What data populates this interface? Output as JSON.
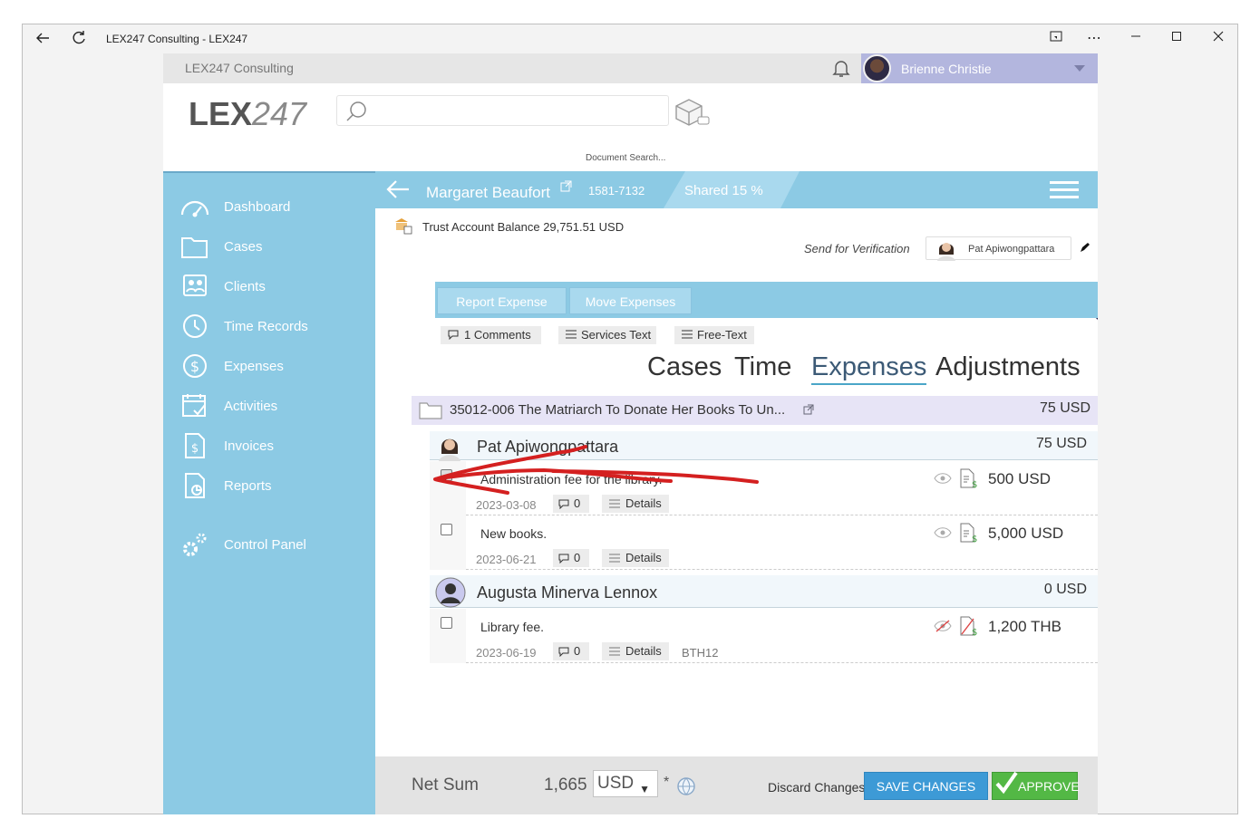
{
  "window": {
    "title": "LEX247 Consulting - LEX247"
  },
  "topbar": {
    "company": "LEX247 Consulting",
    "user_name": "Brienne Christie"
  },
  "header": {
    "logo_bold": "LEX",
    "logo_light": "247",
    "search_placeholder": "",
    "search_hint": "Document Search..."
  },
  "sidebar": {
    "items": [
      {
        "label": "Dashboard",
        "icon": "gauge-icon"
      },
      {
        "label": "Cases",
        "icon": "folder-icon"
      },
      {
        "label": "Clients",
        "icon": "contacts-icon"
      },
      {
        "label": "Time Records",
        "icon": "clock-icon"
      },
      {
        "label": "Expenses",
        "icon": "dollar-icon"
      },
      {
        "label": "Activities",
        "icon": "calendar-icon"
      },
      {
        "label": "Invoices",
        "icon": "invoice-icon"
      },
      {
        "label": "Reports",
        "icon": "report-icon"
      },
      {
        "label": "Control Panel",
        "icon": "gears-icon"
      }
    ]
  },
  "case_bar": {
    "client": "Margaret Beaufort",
    "case_number": "1581-7132",
    "shared": "Shared 15 %"
  },
  "trust": {
    "text": "Trust Account Balance 29,751.51 USD"
  },
  "verification": {
    "label": "Send for Verification",
    "person": "Pat Apiwongpattara"
  },
  "actions": {
    "report_expense": "Report Expense",
    "move_expenses": "Move Expenses"
  },
  "chips": {
    "comments": "1 Comments",
    "services_text": "Services Text",
    "free_text": "Free-Text"
  },
  "tabs": [
    "Cases",
    "Time",
    "Expenses",
    "Adjustments"
  ],
  "active_tab": "Expenses",
  "case_row": {
    "title": "35012-006 The Matriarch To Donate Her Books To Un...",
    "amount": "75 USD"
  },
  "groups": [
    {
      "person": "Pat Apiwongpattara",
      "amount": "75 USD",
      "entries": [
        {
          "desc": "Administration fee for the library.",
          "date": "2023-03-08",
          "comments": "0",
          "details": "Details",
          "code": "",
          "amount": "500 USD",
          "checked": true
        },
        {
          "desc": "New books.",
          "date": "2023-06-21",
          "comments": "0",
          "details": "Details",
          "code": "",
          "amount": "5,000 USD",
          "checked": false
        }
      ]
    },
    {
      "person": "Augusta Minerva Lennox",
      "amount": "0 USD",
      "entries": [
        {
          "desc": "Library fee.",
          "date": "2023-06-19",
          "comments": "0",
          "details": "Details",
          "code": "BTH12",
          "amount": "1,200 THB",
          "checked": false
        }
      ]
    }
  ],
  "footer": {
    "net_label": "Net Sum",
    "net_value": "1,665",
    "currency": "USD",
    "asterisk": "*",
    "discard": "Discard Changes",
    "save": "SAVE CHANGES",
    "approve": "APPROVE"
  },
  "colors": {
    "sidebar": "#8ccae4",
    "user_box": "#b3b6de",
    "case_row": "#e7e4f6",
    "save": "#3d9ad6",
    "approve": "#53b845",
    "annotation": "#d42020"
  }
}
